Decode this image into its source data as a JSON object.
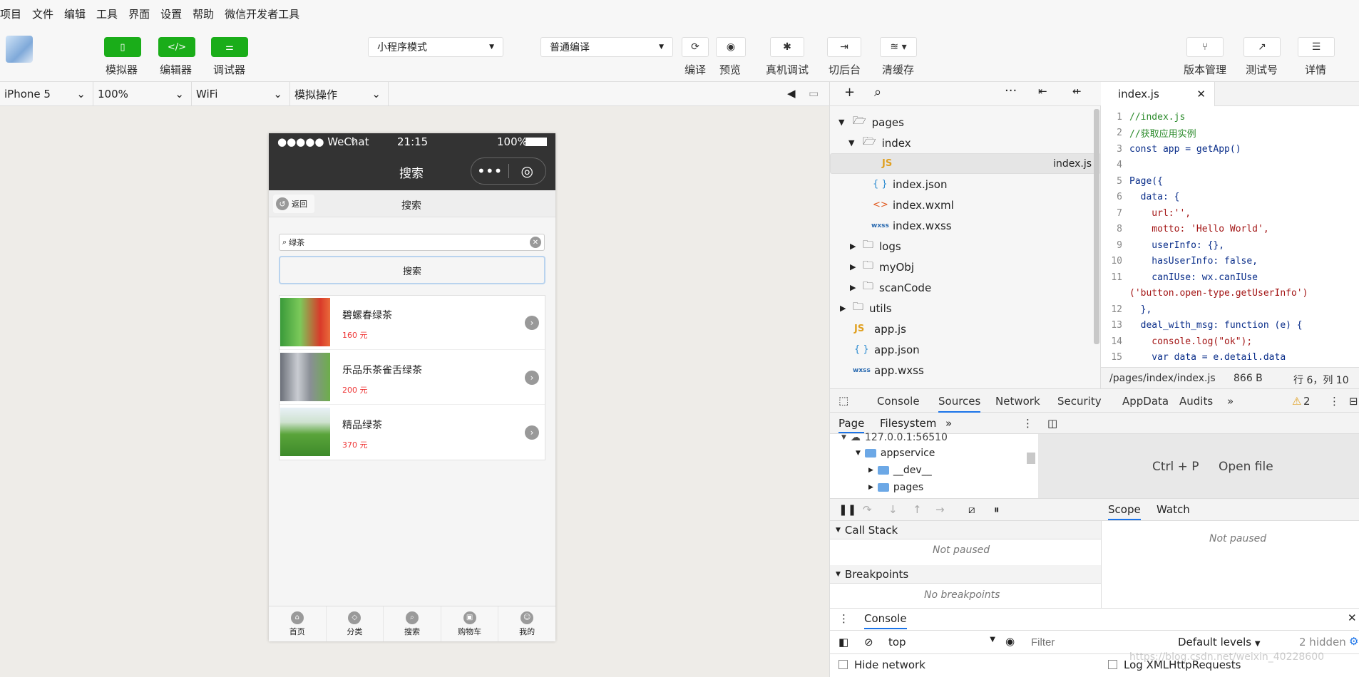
{
  "menu": [
    "项目",
    "文件",
    "编辑",
    "工具",
    "界面",
    "设置",
    "帮助",
    "微信开发者工具"
  ],
  "toolbar": {
    "simulator": "模拟器",
    "editor": "编辑器",
    "debugger": "调试器",
    "mode": "小程序模式",
    "compile_mode": "普通编译",
    "compile": "编译",
    "preview": "预览",
    "remote_debug": "真机调试",
    "background": "切后台",
    "clear_cache": "清缓存",
    "version": "版本管理",
    "test": "测试号",
    "details": "详情"
  },
  "devicebar": {
    "device": "iPhone 5",
    "zoom": "100%",
    "network": "WiFi",
    "operation": "模拟操作"
  },
  "phone": {
    "status_carrier": "●●●●● WeChat",
    "status_time": "21:15",
    "status_battery": "100%",
    "nav_title": "搜索",
    "back_label": "返回",
    "sub_title": "搜索",
    "search_value": "绿茶",
    "search_button": "搜索",
    "products": [
      {
        "name": "碧螺春绿茶",
        "price": "160 元"
      },
      {
        "name": "乐品乐茶雀舌绿茶",
        "price": "200 元"
      },
      {
        "name": "精品绿茶",
        "price": "370 元"
      }
    ],
    "tabs": [
      "首页",
      "分类",
      "搜索",
      "购物车",
      "我的"
    ]
  },
  "tree": {
    "pages": "pages",
    "index": "index",
    "index_js": "index.js",
    "index_json": "index.json",
    "index_wxml": "index.wxml",
    "index_wxss": "index.wxss",
    "logs": "logs",
    "myObj": "myObj",
    "scanCode": "scanCode",
    "utils": "utils",
    "app_js": "app.js",
    "app_json": "app.json",
    "app_wxss": "app.wxss"
  },
  "editor": {
    "tab": "index.js",
    "path": "/pages/index/index.js",
    "size": "866 B",
    "position": "行 6，列 10",
    "lines": [
      {
        "n": "1",
        "t": "//index.js"
      },
      {
        "n": "2",
        "t": "//获取应用实例"
      },
      {
        "n": "3",
        "t": "const app = getApp()"
      },
      {
        "n": "4",
        "t": ""
      },
      {
        "n": "5",
        "t": "Page({"
      },
      {
        "n": "6",
        "t": "  data: {"
      },
      {
        "n": "7",
        "t": "    url:'',"
      },
      {
        "n": "8",
        "t": "    motto: 'Hello World',"
      },
      {
        "n": "9",
        "t": "    userInfo: {},"
      },
      {
        "n": "10",
        "t": "    hasUserInfo: false,"
      },
      {
        "n": "11",
        "t": "    canIUse: wx.canIUse"
      },
      {
        "n": "",
        "t": "('button.open-type.getUserInfo')"
      },
      {
        "n": "12",
        "t": "  },"
      },
      {
        "n": "13",
        "t": "  deal_with_msg: function (e) {"
      },
      {
        "n": "14",
        "t": "    console.log(\"ok\");"
      },
      {
        "n": "15",
        "t": "    var data = e.detail.data"
      }
    ]
  },
  "devtools": {
    "tabs": [
      "Console",
      "Sources",
      "Network",
      "Security",
      "AppData",
      "Audits"
    ],
    "warnings": "2",
    "page_tab": "Page",
    "filesystem_tab": "Filesystem",
    "host": "127.0.0.1:56510",
    "appservice": "appservice",
    "dev": "__dev__",
    "pages": "pages",
    "shortcut": "Ctrl + P",
    "open_file": "Open file",
    "call_stack": "Call Stack",
    "not_paused": "Not paused",
    "breakpoints": "Breakpoints",
    "no_breakpoints": "No breakpoints",
    "scope": "Scope",
    "watch": "Watch",
    "scope_not_paused": "Not paused",
    "console_tab": "Console",
    "context": "top",
    "filter_placeholder": "Filter",
    "levels": "Default levels",
    "hidden": "2 hidden",
    "hide_network": "Hide network",
    "log_xhr": "Log XMLHttpRequests",
    "watermark": "https://blog.csdn.net/weixin_40228600"
  }
}
